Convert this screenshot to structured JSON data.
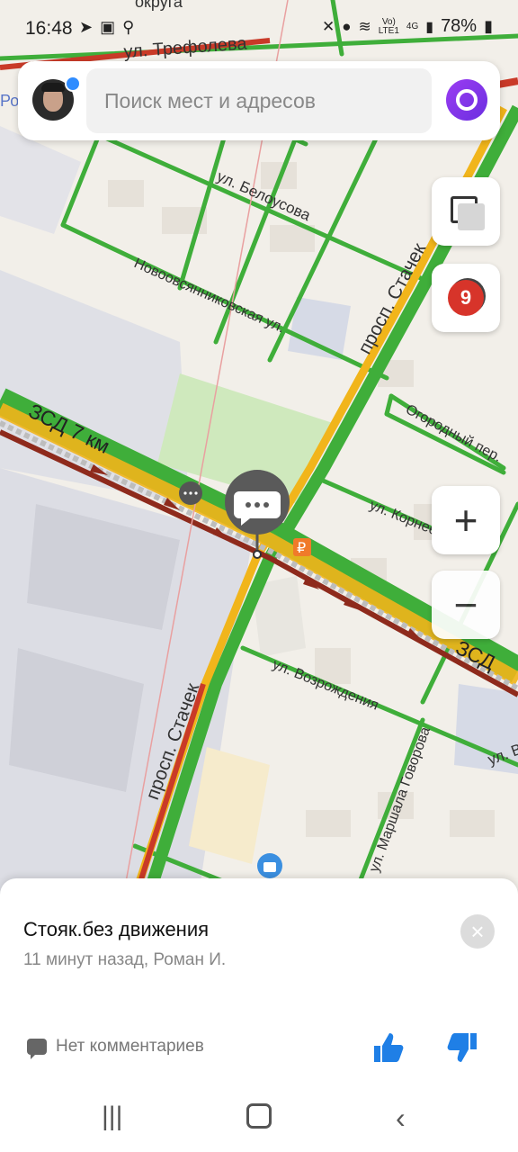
{
  "status_bar": {
    "time": "16:48",
    "network_top": "Vo)",
    "network_bottom": "LTE1",
    "gen": "4G",
    "battery": "78%"
  },
  "search": {
    "placeholder": "Поиск мест и адресов"
  },
  "map": {
    "labels": {
      "okruga": "округа",
      "trefoleva": "ул. Трефолева",
      "ul": "ул.",
      "po": "Ро",
      "belousova": "ул. Белоусова",
      "novoovsyan": "Новоовсянниковская ул.",
      "stachek_top": "просп. Стачек",
      "ogorodny": "Огородный пер.",
      "zsd7": "ЗСД 7 км",
      "kornev": "ул. Корнеева",
      "zsd_right": "ЗСД",
      "vozrozhdeniya": "ул. Возрождения",
      "stachek_bottom": "просп. Стачек",
      "govorova": "ул. Маршала Говорова",
      "ul_right": "ул. В"
    },
    "traffic_level": "9"
  },
  "controls": {
    "zoom_in": "+",
    "zoom_out": "−"
  },
  "event": {
    "title": "Стояк.без движения",
    "meta": "11 минут назад, Роман И.",
    "comments": "Нет комментариев",
    "close": "×"
  },
  "colors": {
    "road_green": "#3fae3a",
    "road_yellow": "#f1b51b",
    "road_red": "#c93a28",
    "road_darkred": "#8e2a1c",
    "accent_blue": "#1f7fe6",
    "alice": "#7b33e6"
  }
}
